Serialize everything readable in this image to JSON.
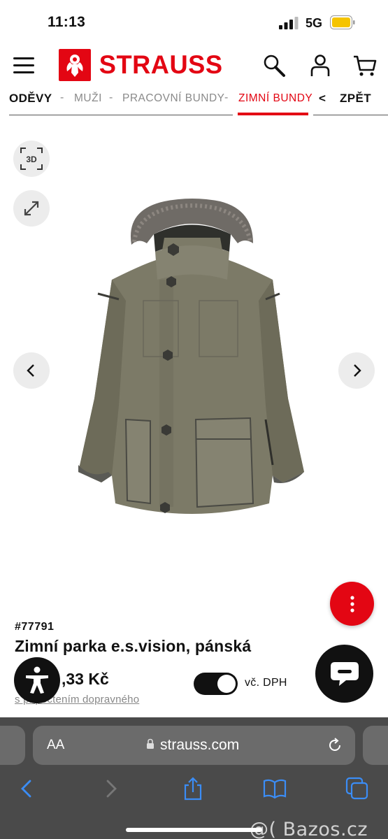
{
  "status_bar": {
    "time": "11:13",
    "network": "5G"
  },
  "header": {
    "logo_text": "STRAUSS"
  },
  "breadcrumb": {
    "items": [
      "ODĚVY",
      "MUŽI",
      "PRACOVNÍ BUNDY",
      "ZIMNÍ BUNDY"
    ],
    "separator": "-",
    "back_arrow": "<",
    "back_label": "ZPĚT"
  },
  "gallery": {
    "btn_3d_label": "3D"
  },
  "product": {
    "sku": "#77791",
    "title": "Zimní parka e.s.vision, pánská",
    "price": ",33 Kč",
    "shipping_note": "s připočtením dopravného",
    "vat_label": "vč. DPH",
    "vat_toggle_on": true
  },
  "browser": {
    "aa_label": "AA",
    "url": "strauss.com"
  },
  "watermark": "@( Bazos.cz",
  "colors": {
    "brand_red": "#e30613",
    "dark": "#111111",
    "toolbar_blue": "#3b8df6"
  }
}
